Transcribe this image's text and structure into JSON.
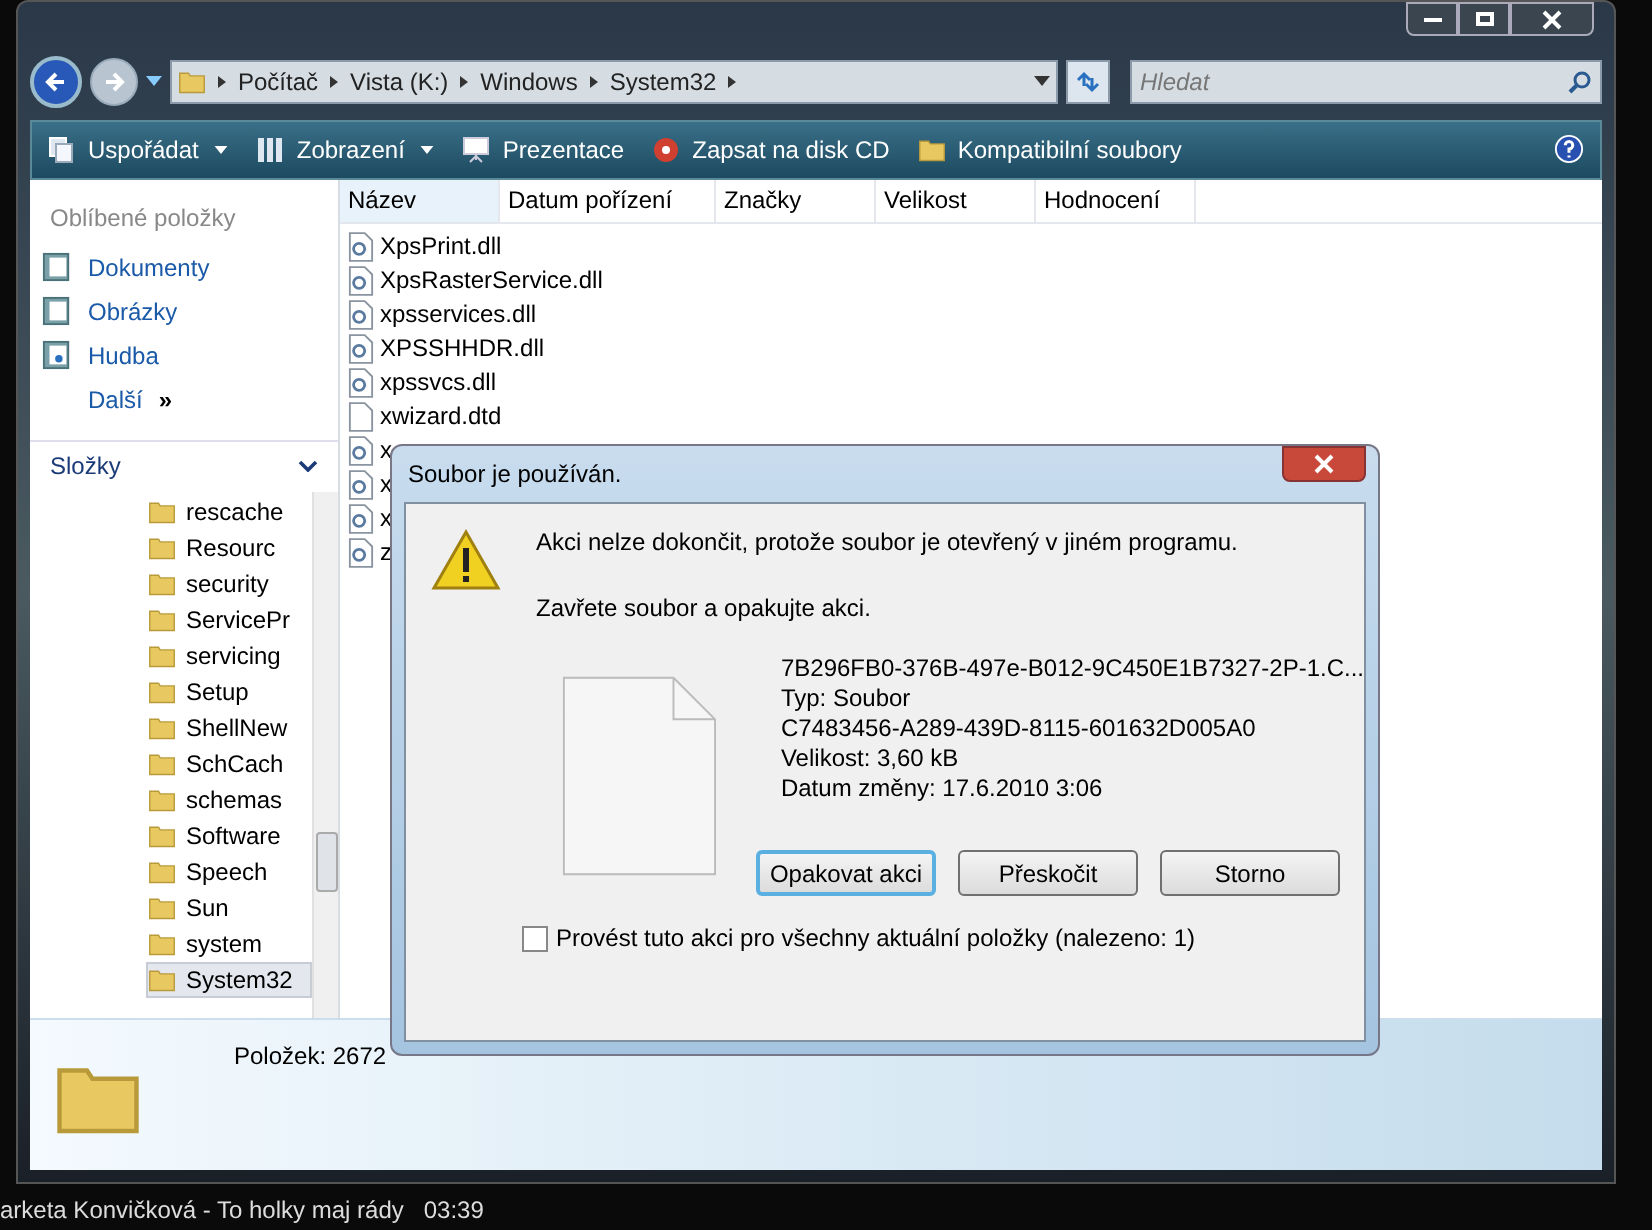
{
  "address_bar": {
    "breadcrumbs": [
      "Počítač",
      "Vista (K:)",
      "Windows",
      "System32"
    ]
  },
  "search": {
    "placeholder": "Hledat"
  },
  "toolbar": {
    "items": [
      {
        "label": "Uspořádat",
        "kind": "organize"
      },
      {
        "label": "Zobrazení",
        "kind": "views"
      },
      {
        "label": "Prezentace",
        "kind": "slideshow"
      },
      {
        "label": "Zapsat na disk CD",
        "kind": "burn"
      },
      {
        "label": "Kompatibilní soubory",
        "kind": "compat"
      }
    ]
  },
  "favorites": {
    "title": "Oblíbené položky",
    "items": [
      {
        "label": "Dokumenty",
        "kind": "docs"
      },
      {
        "label": "Obrázky",
        "kind": "pics"
      },
      {
        "label": "Hudba",
        "kind": "music"
      }
    ],
    "more": "Další",
    "more_glyph": "»"
  },
  "folders": {
    "title": "Složky",
    "items": [
      {
        "label": "rescache",
        "selected": false
      },
      {
        "label": "Resourc",
        "selected": false
      },
      {
        "label": "security",
        "selected": false
      },
      {
        "label": "ServicePr",
        "selected": false
      },
      {
        "label": "servicing",
        "selected": false
      },
      {
        "label": "Setup",
        "selected": false
      },
      {
        "label": "ShellNew",
        "selected": false
      },
      {
        "label": "SchCach",
        "selected": false
      },
      {
        "label": "schemas",
        "selected": false
      },
      {
        "label": "Software",
        "selected": false
      },
      {
        "label": "Speech",
        "selected": false
      },
      {
        "label": "Sun",
        "selected": false
      },
      {
        "label": "system",
        "selected": false
      },
      {
        "label": "System32",
        "selected": true
      }
    ]
  },
  "columns": [
    "Název",
    "Datum pořízení",
    "Značky",
    "Velikost",
    "Hodnocení"
  ],
  "files": [
    {
      "name": "XpsPrint.dll",
      "kind": "dll"
    },
    {
      "name": "XpsRasterService.dll",
      "kind": "dll"
    },
    {
      "name": "xpsservices.dll",
      "kind": "dll"
    },
    {
      "name": "XPSSHHDR.dll",
      "kind": "dll"
    },
    {
      "name": "xpssvcs.dll",
      "kind": "dll"
    },
    {
      "name": "xwizard.dtd",
      "kind": "file"
    },
    {
      "name": "x",
      "kind": "dll"
    },
    {
      "name": "x",
      "kind": "dll"
    },
    {
      "name": "x",
      "kind": "dll"
    },
    {
      "name": "z",
      "kind": "dll"
    }
  ],
  "details": {
    "count": "Položek: 2672"
  },
  "dialog": {
    "title": "Soubor je používán.",
    "message": "Akci nelze dokončit, protože soubor je otevřený v jiném programu.",
    "instruction": "Zavřete soubor a opakujte akci.",
    "file": [
      "7B296FB0-376B-497e-B012-9C450E1B7327-2P-1.C...",
      "Typ: Soubor",
      "C7483456-A289-439D-8115-601632D005A0",
      "Velikost: 3,60 kB",
      "Datum změny: 17.6.2010 3:06"
    ],
    "buttons": [
      {
        "label": "Opakovat akci",
        "default": true
      },
      {
        "label": "Přeskočit",
        "default": false
      },
      {
        "label": "Storno",
        "default": false
      }
    ],
    "checkbox": {
      "label": "Provést tuto akci pro všechny aktuální položky (nalezeno: 1)",
      "checked": false
    }
  },
  "now_playing": {
    "track": "arketa Konvičková - To holky maj rády",
    "time": "03:39"
  }
}
